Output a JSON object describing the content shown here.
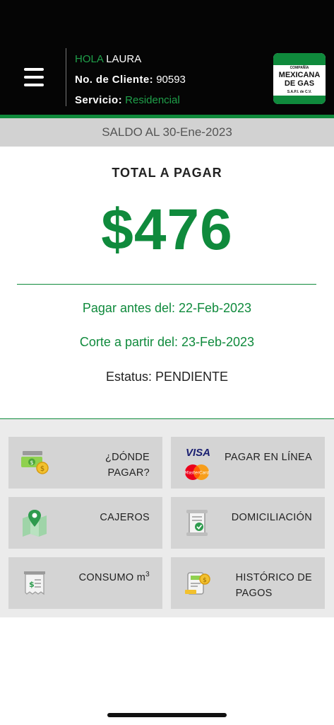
{
  "header": {
    "greeting_prefix": "HOLA",
    "user_name": "LAURA",
    "client_label": "No. de Cliente:",
    "client_number": "90593",
    "service_label": "Servicio:",
    "service_value": "Residencial"
  },
  "logo": {
    "company_small": "COMPAÑÍA",
    "line1": "MEXICANA",
    "line2": "DE GAS",
    "suffix": "S.A.P.I. de C.V."
  },
  "balance": {
    "saldo_label": "SALDO AL 30-Ene-2023",
    "total_label": "TOTAL A PAGAR",
    "amount": "$476",
    "due_text": "Pagar antes del: 22-Feb-2023",
    "cut_text": "Corte a partir del: 23-Feb-2023",
    "status_text": "Estatus: PENDIENTE"
  },
  "menu": {
    "donde_pagar_1": "¿DÓNDE",
    "donde_pagar_2": "PAGAR?",
    "pagar_en_linea": "PAGAR EN LÍNEA",
    "visa": "VISA",
    "mastercard": "MasterCard",
    "cajeros": "CAJEROS",
    "domiciliacion": "DOMICILIACIÓN",
    "consumo": "CONSUMO m",
    "consumo_sup": "3",
    "historico_1": "HISTÓRICO DE",
    "historico_2": "PAGOS"
  },
  "colors": {
    "brand_green": "#0f8a3c",
    "header_bg": "#050505"
  },
  "icons": [
    "hamburger-menu-icon",
    "cash-coin-icon",
    "map-pin-icon",
    "document-check-icon",
    "receipt-money-icon",
    "meter-coin-icon"
  ]
}
